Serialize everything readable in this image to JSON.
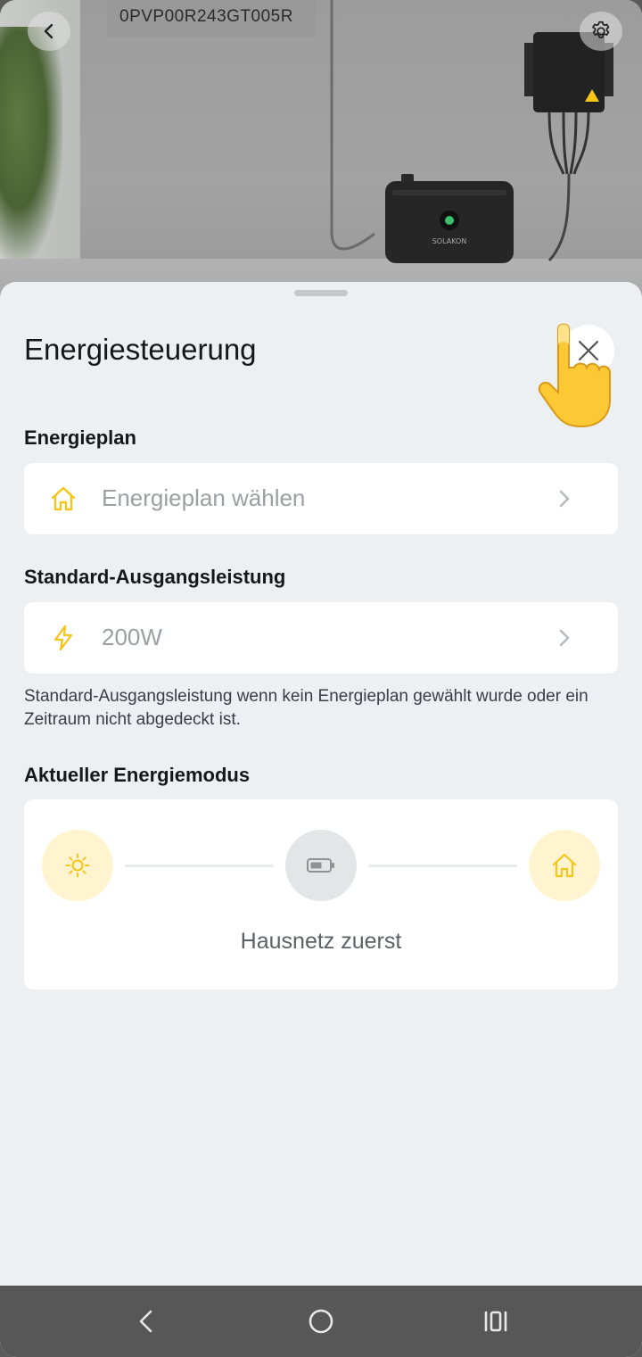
{
  "header": {
    "device_id": "0PVP00R243GT005R",
    "icons": {
      "back": "chevron-left-icon",
      "settings": "gear-icon"
    }
  },
  "sheet": {
    "title": "Energiesteuerung",
    "close_icon": "close-icon"
  },
  "energy_plan": {
    "section_label": "Energieplan",
    "icon": "home-icon",
    "value": "Energieplan wählen"
  },
  "output_power": {
    "section_label": "Standard-Ausgangsleistung",
    "icon": "lightning-icon",
    "value": "200W",
    "hint": "Standard-Ausgangsleistung wenn kein Energieplan gewählt wurde oder ein Zeitraum nicht abgedeckt ist."
  },
  "energy_mode": {
    "section_label": "Aktueller Energiemodus",
    "nodes": [
      {
        "icon": "sun-icon",
        "active": true
      },
      {
        "icon": "battery-icon",
        "active": false
      },
      {
        "icon": "home-icon",
        "active": true
      }
    ],
    "mode_text": "Hausnetz zuerst"
  },
  "colors": {
    "accent": "#f5c518",
    "accent_bg": "#fff4cf",
    "inactive_bg": "#e4e5e7",
    "sheet_bg": "#edf0f3"
  },
  "navbar": {
    "icons": [
      "back-nav-icon",
      "home-nav-icon",
      "recents-nav-icon"
    ]
  }
}
